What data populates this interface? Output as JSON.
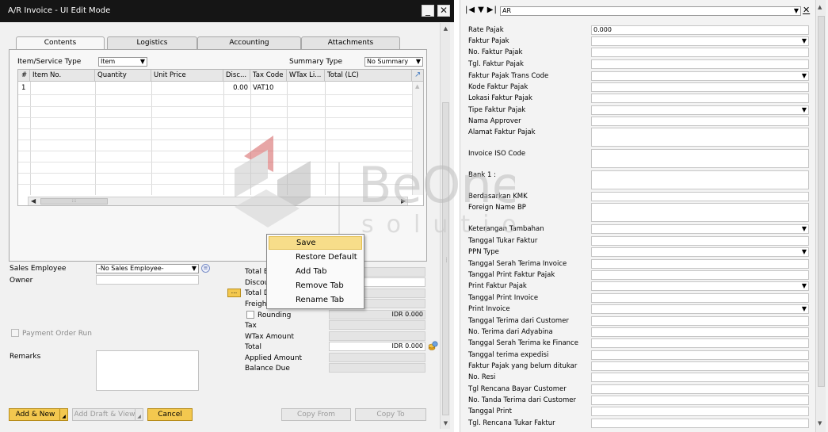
{
  "window": {
    "title": "A/R Invoice - UI Edit Mode",
    "minimize_glyph": "_",
    "close_glyph": "✕"
  },
  "tabs": [
    "Contents",
    "Logistics",
    "Accounting",
    "Attachments"
  ],
  "header_fields": {
    "item_service_type_label": "Item/Service Type",
    "item_service_type_value": "Item",
    "summary_type_label": "Summary Type",
    "summary_type_value": "No Summary"
  },
  "grid": {
    "columns": [
      "#",
      "Item No.",
      "Quantity",
      "Unit Price",
      "Disc...",
      "Tax Code",
      "WTax Li...",
      "Total (LC)"
    ],
    "rows": [
      {
        "num": "1",
        "item_no": "",
        "quantity": "",
        "unit_price": "",
        "discount": "0.00",
        "tax_code": "VAT10",
        "wtax": "",
        "total": ""
      }
    ],
    "scroll_grip": ":::"
  },
  "sales_employee": {
    "label": "Sales Employee",
    "value": "-No Sales Employee-"
  },
  "owner": {
    "label": "Owner",
    "value": ""
  },
  "payment_order_run": {
    "label": "Payment Order Run"
  },
  "remarks": {
    "label": "Remarks"
  },
  "totals": {
    "rows": [
      {
        "label": "Total B",
        "value": ""
      },
      {
        "label": "Discou",
        "value": ""
      },
      {
        "label": "Total D",
        "value": ""
      },
      {
        "label": "Freigh",
        "value": ""
      },
      {
        "label": "Rounding",
        "value": "IDR 0.000"
      },
      {
        "label": "Tax",
        "value": ""
      },
      {
        "label": "WTax Amount",
        "value": ""
      },
      {
        "label": "Total",
        "value": "IDR 0.000"
      },
      {
        "label": "Applied Amount",
        "value": ""
      },
      {
        "label": "Balance Due",
        "value": ""
      }
    ],
    "ellipsis": "..."
  },
  "context_menu": {
    "items": [
      "Save",
      "Restore Default",
      "Add Tab",
      "Remove Tab",
      "Rename Tab"
    ],
    "highlighted": "Save"
  },
  "buttons": {
    "add_new": "Add & New",
    "add_draft": "Add Draft & View",
    "cancel": "Cancel",
    "copy_from": "Copy From",
    "copy_to": "Copy To"
  },
  "watermark": {
    "line1": "BeOne",
    "line2": "solution"
  },
  "udf_panel": {
    "category": "AR",
    "close_glyph": "✕",
    "fields": [
      {
        "label": "Rate Pajak",
        "value": "0.000",
        "dropdown": false
      },
      {
        "label": "Faktur Pajak",
        "value": "",
        "dropdown": true
      },
      {
        "label": "No. Faktur Pajak",
        "value": "",
        "dropdown": false
      },
      {
        "label": "Tgl. Faktur Pajak",
        "value": "",
        "dropdown": false
      },
      {
        "label": "Faktur Pajak Trans Code",
        "value": "",
        "dropdown": true
      },
      {
        "label": "Kode Faktur Pajak",
        "value": "",
        "dropdown": false
      },
      {
        "label": "Lokasi Faktur Pajak",
        "value": "",
        "dropdown": false
      },
      {
        "label": "Tipe Faktur Pajak",
        "value": "",
        "dropdown": true
      },
      {
        "label": "Nama Approver",
        "value": "",
        "dropdown": false
      },
      {
        "label": "Alamat Faktur Pajak",
        "value": "",
        "dropdown": false
      },
      {
        "label": "Invoice ISO Code",
        "value": "",
        "dropdown": false
      },
      {
        "label": "Bank 1 :",
        "value": "",
        "dropdown": false
      },
      {
        "label": "Berdasarkan KMK",
        "value": "",
        "dropdown": false
      },
      {
        "label": "Foreign Name BP",
        "value": "",
        "dropdown": false
      },
      {
        "label": "Keterangan Tambahan",
        "value": "",
        "dropdown": true
      },
      {
        "label": "Tanggal Tukar Faktur",
        "value": "",
        "dropdown": false
      },
      {
        "label": "PPN Type",
        "value": "",
        "dropdown": true
      },
      {
        "label": "Tanggal Serah Terima Invoice",
        "value": "",
        "dropdown": false
      },
      {
        "label": "Tanggal Print Faktur Pajak",
        "value": "",
        "dropdown": false
      },
      {
        "label": "Print Faktur Pajak",
        "value": "",
        "dropdown": true
      },
      {
        "label": "Tanggal Print Invoice",
        "value": "",
        "dropdown": false
      },
      {
        "label": "Print Invoice",
        "value": "",
        "dropdown": true
      },
      {
        "label": "Tanggal Terima dari Customer",
        "value": "",
        "dropdown": false
      },
      {
        "label": "No. Terima dari Adyabina",
        "value": "",
        "dropdown": false
      },
      {
        "label": "Tanggal Serah Terima ke Finance",
        "value": "",
        "dropdown": false
      },
      {
        "label": "Tanggal terima expedisi",
        "value": "",
        "dropdown": false
      },
      {
        "label": "Faktur Pajak yang belum ditukar",
        "value": "",
        "dropdown": false
      },
      {
        "label": "No. Resi",
        "value": "",
        "dropdown": false
      },
      {
        "label": "Tgl Rencana Bayar Customer",
        "value": "",
        "dropdown": false
      },
      {
        "label": "No. Tanda Terima dari Customer",
        "value": "",
        "dropdown": false
      },
      {
        "label": "Tanggal Print",
        "value": "",
        "dropdown": false
      },
      {
        "label": "Tgl. Rencana Tukar Faktur",
        "value": "",
        "dropdown": false
      }
    ]
  }
}
